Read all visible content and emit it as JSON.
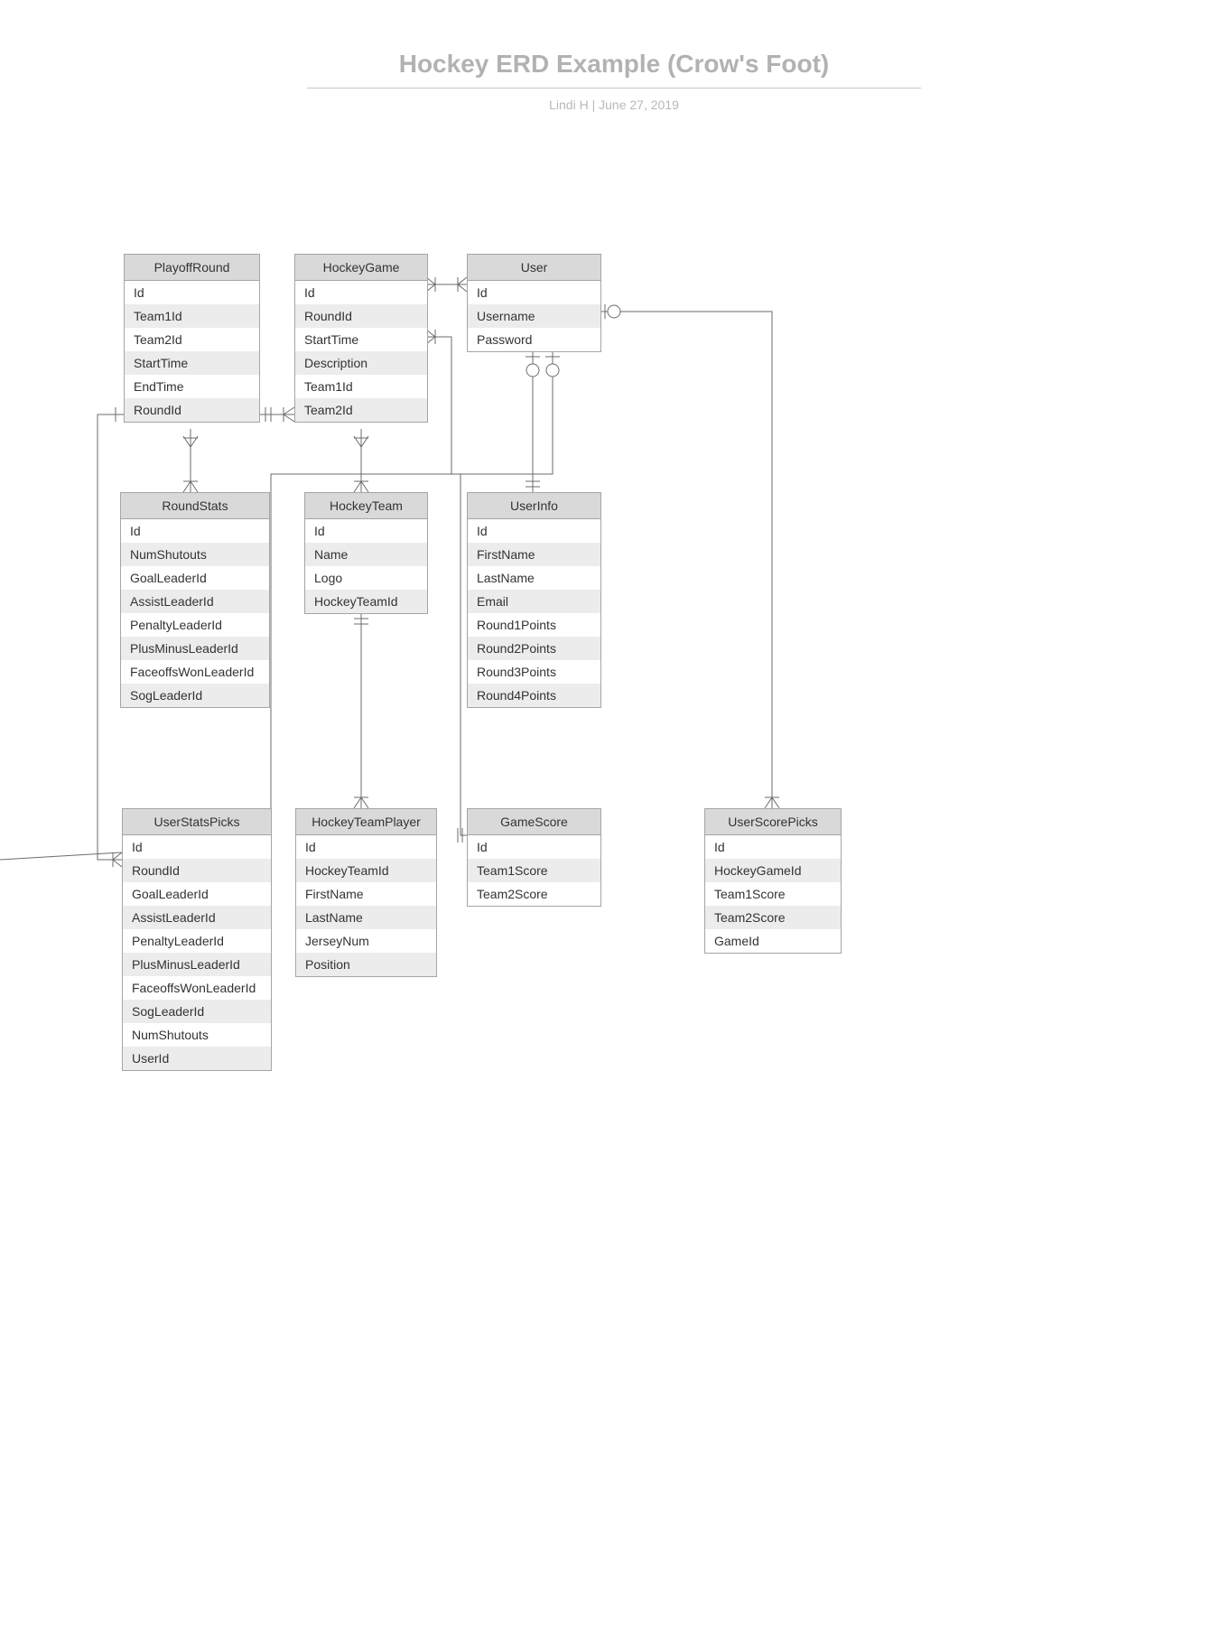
{
  "header": {
    "title": "Hockey ERD Example (Crow's Foot)",
    "subtitle": "Lindi H  |  June 27, 2019"
  },
  "entities": {
    "PlayoffRound": {
      "name": "PlayoffRound",
      "fields": [
        "Id",
        "Team1Id",
        "Team2Id",
        "StartTime",
        "EndTime",
        "RoundId"
      ]
    },
    "HockeyGame": {
      "name": "HockeyGame",
      "fields": [
        "Id",
        "RoundId",
        "StartTime",
        "Description",
        "Team1Id",
        "Team2Id"
      ]
    },
    "User": {
      "name": "User",
      "fields": [
        "Id",
        "Username",
        "Password"
      ]
    },
    "RoundStats": {
      "name": "RoundStats",
      "fields": [
        "Id",
        "NumShutouts",
        "GoalLeaderId",
        "AssistLeaderId",
        "PenaltyLeaderId",
        "PlusMinusLeaderId",
        "FaceoffsWonLeaderId",
        "SogLeaderId"
      ]
    },
    "HockeyTeam": {
      "name": "HockeyTeam",
      "fields": [
        "Id",
        "Name",
        "Logo",
        "HockeyTeamId"
      ]
    },
    "UserInfo": {
      "name": "UserInfo",
      "fields": [
        "Id",
        "FirstName",
        "LastName",
        "Email",
        "Round1Points",
        "Round2Points",
        "Round3Points",
        "Round4Points"
      ]
    },
    "UserStatsPicks": {
      "name": "UserStatsPicks",
      "fields": [
        "Id",
        "RoundId",
        "GoalLeaderId",
        "AssistLeaderId",
        "PenaltyLeaderId",
        "PlusMinusLeaderId",
        "FaceoffsWonLeaderId",
        "SogLeaderId",
        "NumShutouts",
        "UserId"
      ]
    },
    "HockeyTeamPlayer": {
      "name": "HockeyTeamPlayer",
      "fields": [
        "Id",
        "HockeyTeamId",
        "FirstName",
        "LastName",
        "JerseyNum",
        "Position"
      ]
    },
    "GameScore": {
      "name": "GameScore",
      "fields": [
        "Id",
        "Team1Score",
        "Team2Score"
      ]
    },
    "UserScorePicks": {
      "name": "UserScorePicks",
      "fields": [
        "Id",
        "HockeyGameId",
        "Team1Score",
        "Team2Score",
        "GameId"
      ]
    }
  }
}
